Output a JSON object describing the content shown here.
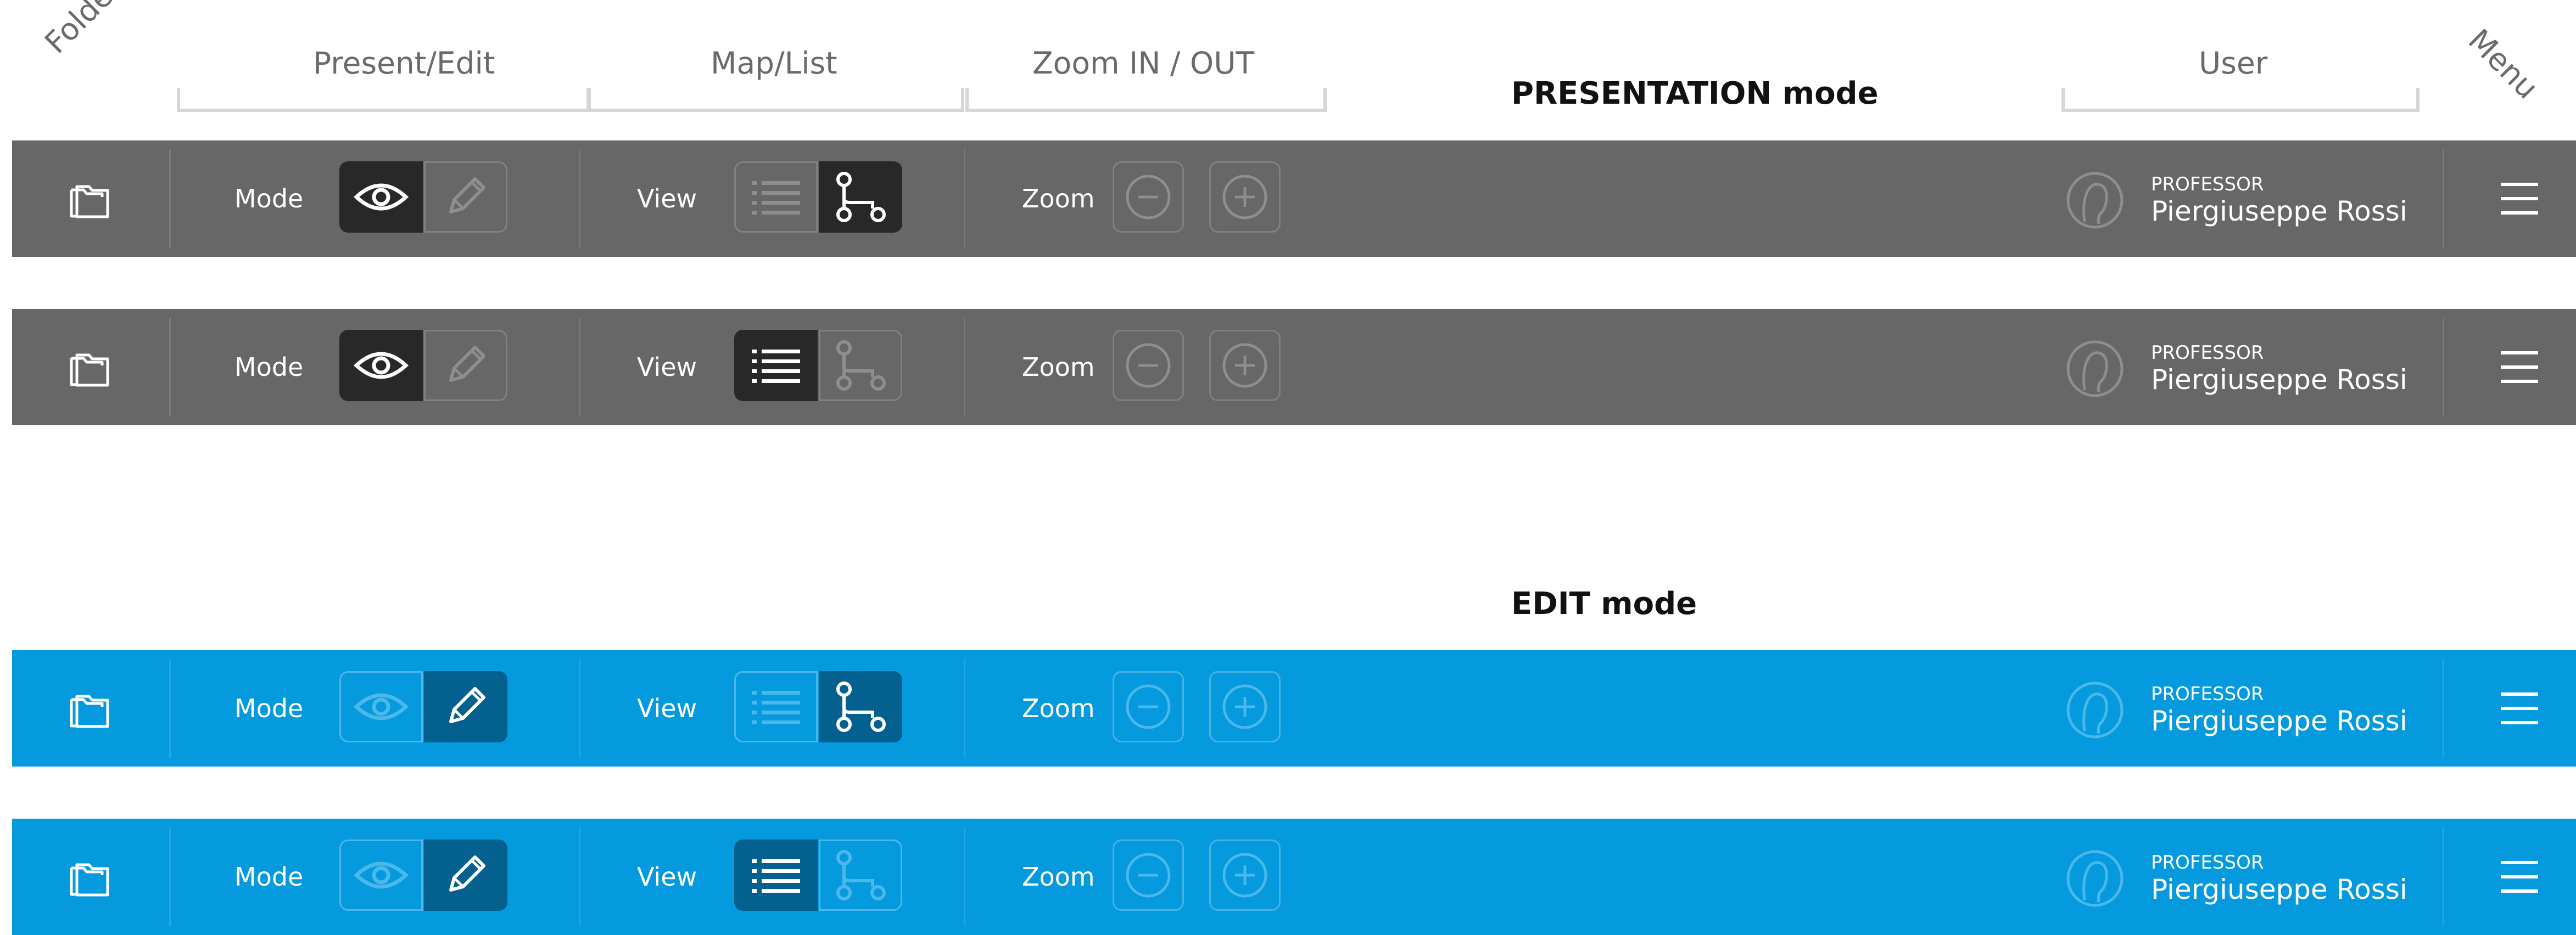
{
  "annotations": {
    "folders": "Folders",
    "present_edit": "Present/Edit",
    "map_list": "Map/List",
    "zoom": "Zoom IN / OUT",
    "user": "User",
    "menu": "Menu"
  },
  "section_titles": {
    "presentation": "PRESENTATION mode",
    "edit": "EDIT mode"
  },
  "toolbar": {
    "mode_label": "Mode",
    "view_label": "View",
    "zoom_label": "Zoom",
    "user_role": "PROFESSOR",
    "user_name": "Piergiuseppe Rossi"
  },
  "colors": {
    "presentation_bar": "#676767",
    "edit_bar": "#0599dd",
    "active_segment_presentation": "#282828",
    "active_segment_edit": "#04608e"
  },
  "toolbars": [
    {
      "theme": "gray",
      "mode": "present",
      "view": "map"
    },
    {
      "theme": "gray",
      "mode": "present",
      "view": "list"
    },
    {
      "theme": "blue",
      "mode": "edit",
      "view": "map"
    },
    {
      "theme": "blue",
      "mode": "edit",
      "view": "list"
    }
  ],
  "icons": [
    "folder-icon",
    "eye-icon",
    "pencil-icon",
    "list-icon",
    "map-tree-icon",
    "zoom-out-icon",
    "zoom-in-icon",
    "user-avatar-icon",
    "hamburger-menu-icon"
  ]
}
